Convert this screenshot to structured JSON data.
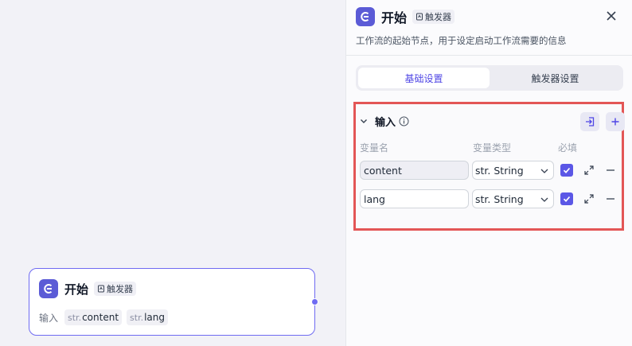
{
  "node": {
    "title": "开始",
    "tag_label": "触发器",
    "inputs_label": "输入",
    "variables": [
      {
        "prefix": "str.",
        "name": "content"
      },
      {
        "prefix": "str.",
        "name": "lang"
      }
    ]
  },
  "panel": {
    "title": "开始",
    "tag_label": "触发器",
    "description": "工作流的起始节点，用于设定启动工作流需要的信息",
    "tabs": [
      {
        "label": "基础设置",
        "active": true
      },
      {
        "label": "触发器设置",
        "active": false
      }
    ],
    "section": {
      "title": "输入",
      "columns": {
        "name": "变量名",
        "type": "变量类型",
        "required": "必填"
      },
      "rows": [
        {
          "name": "content",
          "type": "str. String",
          "required": true
        },
        {
          "name": "lang",
          "type": "str. String",
          "required": true
        }
      ]
    }
  },
  "colors": {
    "accent": "#5b5bd6",
    "highlight_border": "#e35656",
    "checkbox": "#5b57e6"
  },
  "icons": {
    "app": "start-icon",
    "tag": "trigger-icon",
    "close": "close-icon",
    "collapse": "chevron-down-icon",
    "info": "info-icon",
    "import": "import-icon",
    "add": "plus-icon",
    "expand": "expand-icon",
    "remove": "minus-icon"
  }
}
